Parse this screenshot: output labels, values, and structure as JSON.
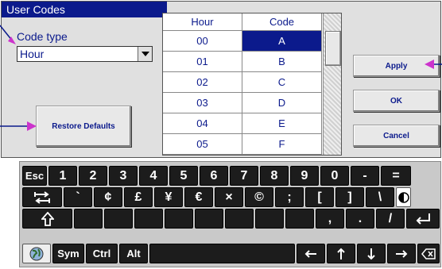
{
  "dialog": {
    "title": "User Codes",
    "code_type_label": "Code type",
    "code_type_value": "Hour",
    "buttons": {
      "restore": "Restore Defaults",
      "apply": "Apply",
      "ok": "OK",
      "cancel": "Cancel"
    }
  },
  "table": {
    "headers": [
      "Hour",
      "Code"
    ],
    "rows": [
      [
        "00",
        "A"
      ],
      [
        "01",
        "B"
      ],
      [
        "02",
        "C"
      ],
      [
        "03",
        "D"
      ],
      [
        "04",
        "E"
      ],
      [
        "05",
        "F"
      ]
    ],
    "selected_row": 0
  },
  "keyboard": {
    "row1": [
      "Esc",
      "1",
      "2",
      "3",
      "4",
      "5",
      "6",
      "7",
      "8",
      "9",
      "0",
      "-",
      "="
    ],
    "row2": [
      "`",
      "¢",
      "£",
      "¥",
      "€",
      "×",
      "©",
      ";",
      "[",
      "]",
      "\\"
    ],
    "row3": [
      ",",
      ".",
      "/"
    ],
    "row4": [
      "Sym",
      "Ctrl",
      "Alt"
    ]
  },
  "colors": {
    "title_bar": "#0b1a8c",
    "text": "#0b1a8c",
    "selected": "#0b1a8c",
    "callout_arrow": "#cc33cc"
  }
}
